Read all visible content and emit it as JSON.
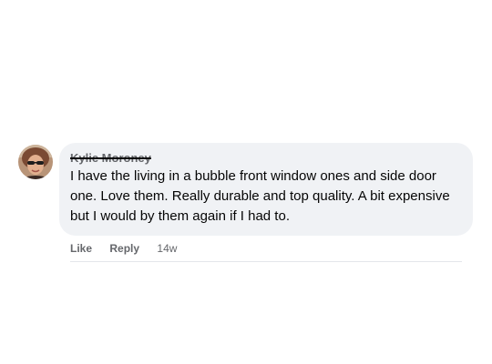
{
  "comment": {
    "author": "Kylie Moroney",
    "text": "I have the living in a bubble front window ones and side door one. Love them. Really durable and top quality. A bit expensive but I would by them again if I had to.",
    "actions": {
      "like_label": "Like",
      "reply_label": "Reply",
      "timestamp": "14w"
    }
  },
  "colors": {
    "bubble_background": "#f0f2f5",
    "text": "#050505",
    "secondary_text": "#65676b"
  },
  "icons": {
    "avatar": "profile-photo"
  }
}
